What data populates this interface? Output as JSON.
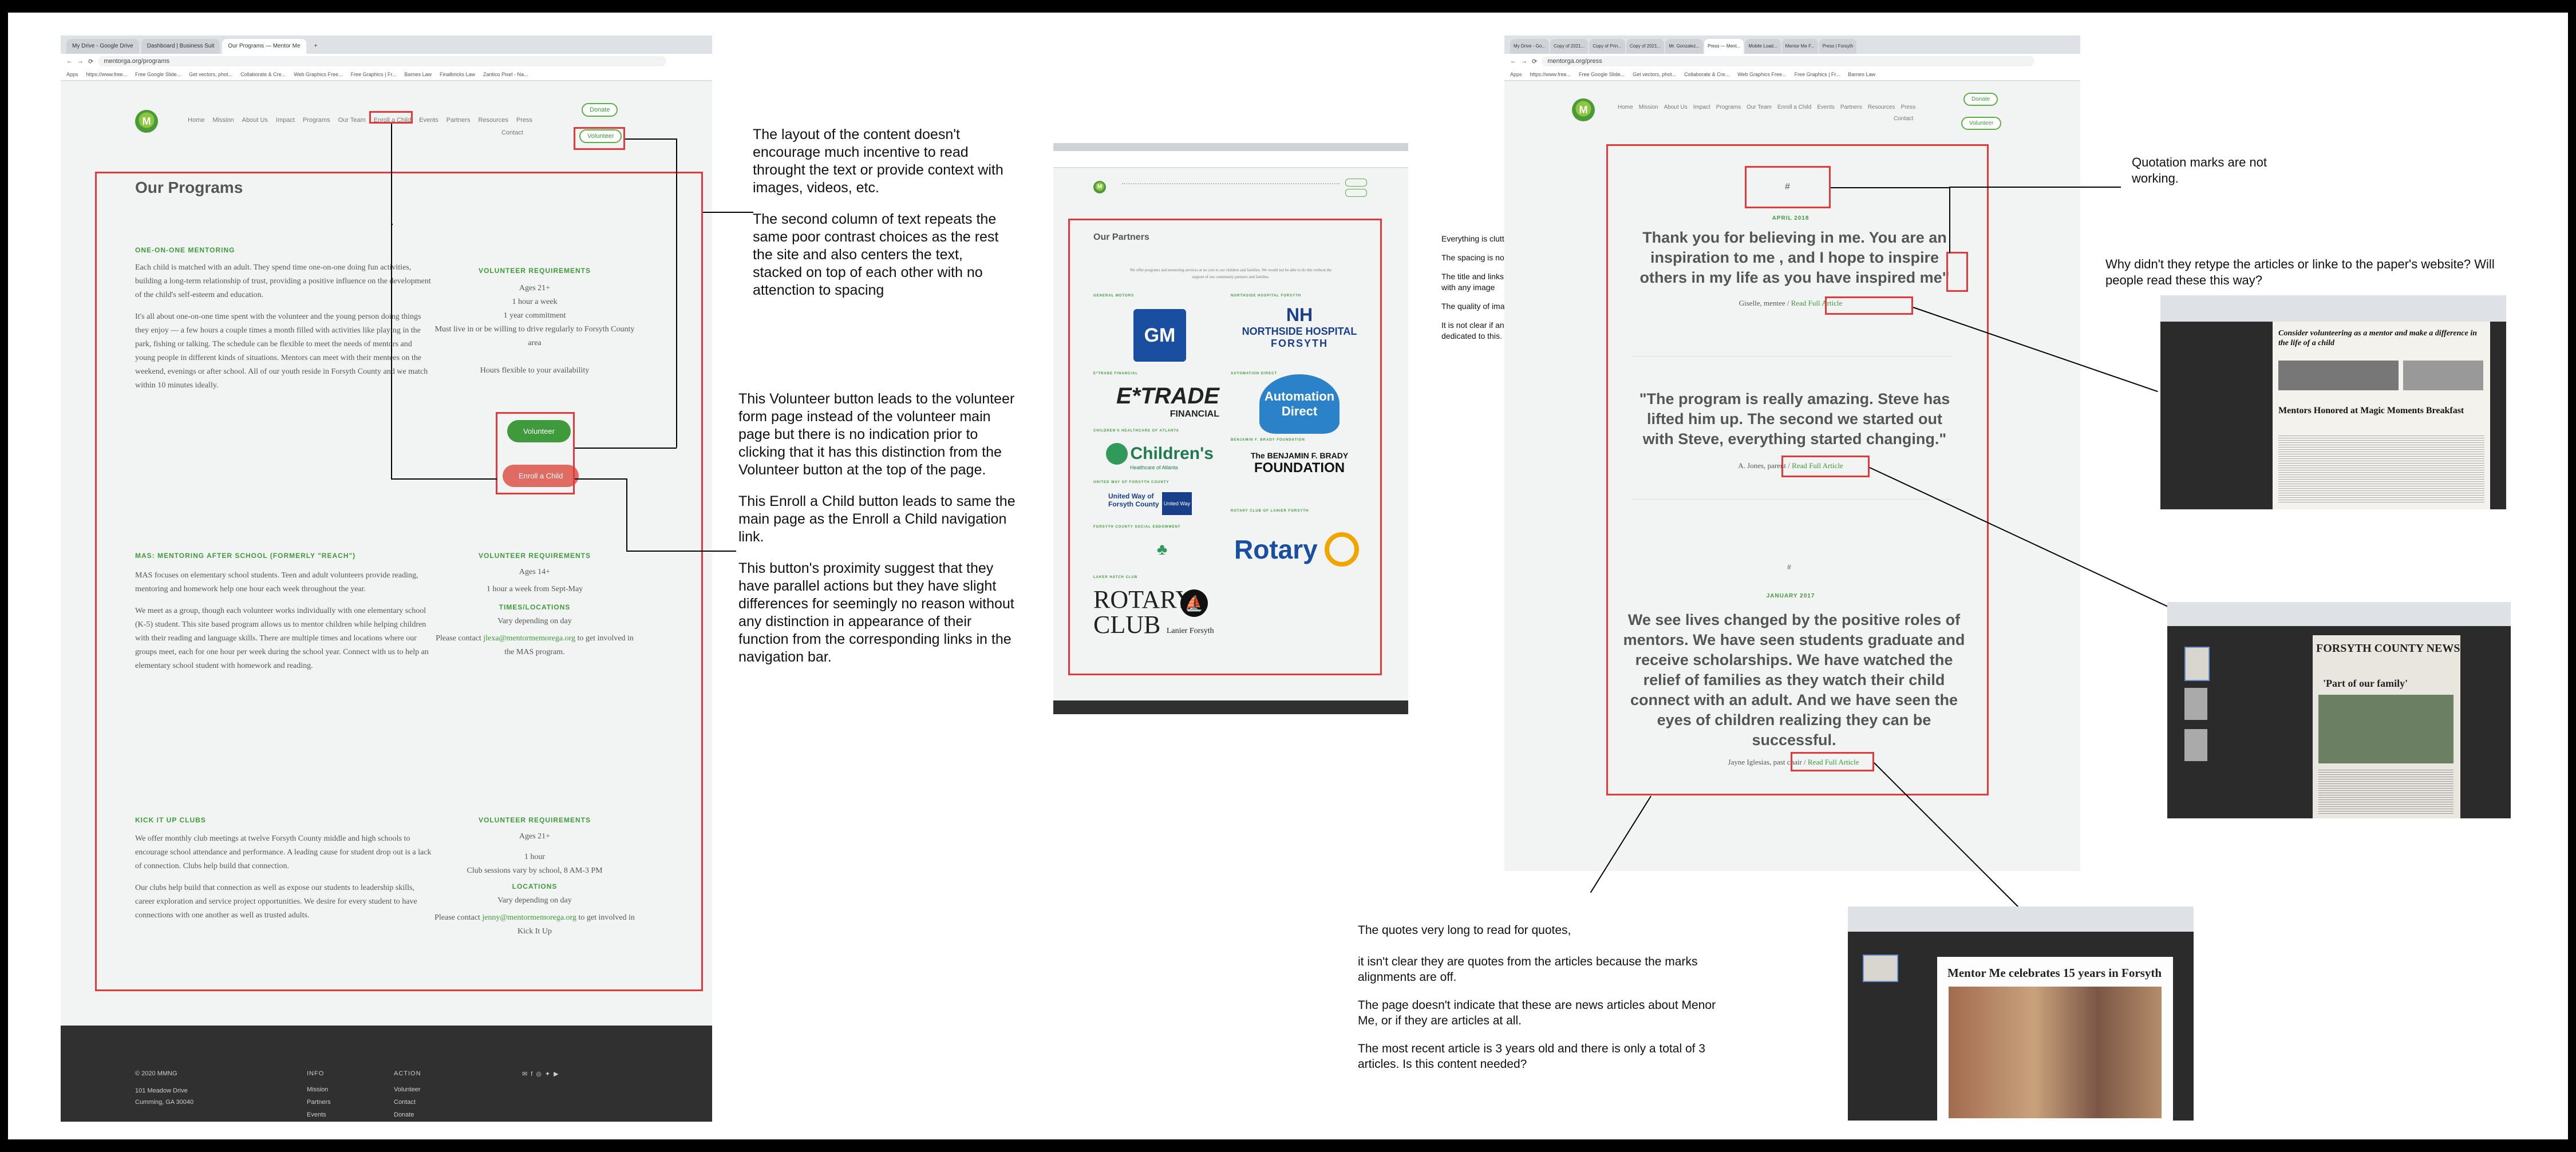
{
  "colors": {
    "accent_green": "#3e9a3a",
    "annotation_red": "#e23a3a",
    "button_red": "#e06b63",
    "footer_bg": "#303030",
    "site_bg": "#f2f4f3"
  },
  "shot1": {
    "tabs": [
      "My Drive - Google Drive",
      "Dashboard | Business Suit",
      "Our Programs — Mentor Me"
    ],
    "url": "mentorga.org/programs",
    "bookmarks": [
      "Apps",
      "https://www.free...",
      "Free Google Slide...",
      "Get vectors, phot...",
      "Collaborate & Cre...",
      "Web Graphics Free...",
      "Free Graphics | Fr...",
      "Barnes Law",
      "Finalbricks Law",
      "Zantico Pixel - Na..."
    ],
    "nav": [
      "Home",
      "Mission",
      "About Us",
      "Impact",
      "Programs",
      "Our Team",
      "Enroll a Child",
      "Events",
      "Partners",
      "Resources",
      "Press",
      "Contact"
    ],
    "donate": "Donate",
    "volunteer_top": "Volunteer",
    "page_title": "Our Programs",
    "sections": [
      {
        "heading": "ONE-ON-ONE MENTORING",
        "paragraphs": [
          "Each child is matched with an adult. They spend time one-on-one doing fun activities, building a long-term relationship of trust, providing a positive influence on the development of the child's self-esteem and education.",
          "It's all about one-on-one time spent with the volunteer and the young person doing things they enjoy — a few hours a couple times a month filled with activities like playing in the park, fishing or talking. The schedule can be flexible to meet the needs of mentors and young people in different kinds of situations. Mentors can meet with their mentees on the weekend, evenings or after school. All of our youth reside in Forsyth County and we match within 10 minutes ideally."
        ],
        "req_head": "VOLUNTEER REQUIREMENTS",
        "req_lines": [
          "Ages 21+",
          "1 hour a week",
          "1 year commitment",
          "Must live in or be willing to drive regularly to Forsyth County area",
          "",
          "Hours flexible to your availability"
        ]
      },
      {
        "heading": "MAS: MENTORING AFTER SCHOOL (FORMERLY \"REACH\")",
        "paragraphs": [
          "MAS focuses on elementary school students. Teen and adult volunteers provide reading, mentoring and homework help one hour each week throughout the year.",
          "We meet as a group, though each volunteer works individually with one elementary school (K-5) student. This site based program allows us to mentor children while helping children with their reading and language skills. There are multiple times and locations where our groups meet, each for one hour per week during the school year. Connect with us to help an elementary school student with homework and reading."
        ],
        "req_head": "VOLUNTEER REQUIREMENTS",
        "req_lines": [
          "Ages 14+",
          "1 hour a week from Sept-May"
        ],
        "times_head": "TIMES/LOCATIONS",
        "times_lines": [
          "Vary depending on day"
        ],
        "contact_pre": "Please contact",
        "contact_email": "jlexa@mentormemorega.org",
        "contact_post": "to get involved in the MAS program."
      },
      {
        "heading": "KICK IT UP CLUBS",
        "paragraphs": [
          "We offer monthly club meetings at twelve Forsyth County middle and high schools to encourage school attendance and performance. A leading cause for student drop out is a lack of connection. Clubs help build that connection.",
          "Our clubs help build that connection as well as expose our students to leadership skills, career exploration and service project opportunities. We desire for every student to have connections with one another as well as trusted adults."
        ],
        "req_head": "VOLUNTEER REQUIREMENTS",
        "req_lines": [
          "Ages 21+",
          "",
          "1 hour",
          "Club sessions vary by school, 8 AM-3 PM"
        ],
        "times_head": "LOCATIONS",
        "times_lines": [
          "Vary depending on day"
        ],
        "contact_pre": "Please contact",
        "contact_email": "jenny@mentormemorega.org",
        "contact_post": "to get involved in Kick It Up"
      }
    ],
    "btn_volunteer": "Volunteer",
    "btn_enroll": "Enroll a Child",
    "footer": {
      "copyright": "© 2020 MMNG",
      "addr1": "101 Meadow Drive",
      "addr2": "Cumming, GA 30040",
      "info_head": "INFO",
      "info_links": [
        "Mission",
        "Partners",
        "Events"
      ],
      "action_head": "ACTION",
      "action_links": [
        "Volunteer",
        "Contact",
        "Donate"
      ]
    }
  },
  "notes1": {
    "p1": "The layout of the content doesn't encourage much incentive to read throught the text or provide context with images, videos, etc.",
    "p2": "The second column of text repeats the same poor contrast choices as the rest the site and also centers the text, stacked on top of each other with no attenction to spacing",
    "p3": "This Volunteer button leads to the volunteer form page instead of the volunteer main page but there is no indication prior to clicking that it has this distinction from the Volunteer button at the top of the page.",
    "p4": "This Enroll a Child button leads to same the main page as the Enroll a Child navigation link.",
    "p5": "This button's proximity suggest that they have parallel actions but they have slight differences for seemingly no reason without any distinction in appearance of their function from the corresponding links in the navigation bar."
  },
  "shot2": {
    "title": "Our Partners",
    "intro": "We offer programs and mentoring services at no cost to our children and families. We would not be able to do this without the support of our community partners and families.",
    "groups": [
      "GENERAL MOTORS",
      "NORTHSIDE HOSPITAL FORSYTH",
      "E*TRADE FINANCIAL",
      "AUTOMATION DIRECT",
      "CHILDREN'S HEALTHCARE OF ATLANTA",
      "BENJAMIN F. BRADY FOUNDATION",
      "UNITED WAY OF FORSYTH COUNTY",
      "ROTARY CLUB OF LANIER FORSYTH",
      "FORSYTH COUNTY SOCIAL ENDOWMENT",
      "LAKER HATCH CLUB"
    ],
    "logos": {
      "gm": "GM",
      "northside1": "NORTHSIDE HOSPITAL",
      "northside2": "FORSYTH",
      "etrade1": "E*TRADE",
      "etrade2": "FINANCIAL",
      "automation": "Automation Direct",
      "childrens1": "Children's",
      "childrens2": "Healthcare of Atlanta",
      "brady1": "The BENJAMIN F. BRADY",
      "brady2": "FOUNDATION",
      "unitedway1": "United Way of",
      "unitedway2": "Forsyth County",
      "rotary": "Rotary",
      "rotaryclub1": "ROTARY",
      "rotaryclub2": "CLUB",
      "rotaryclub3": "Lanier Forsyth"
    }
  },
  "notes2": {
    "p1": "Everything is cluttered and disorganized.",
    "p2": "The spacing is not consistent",
    "p3": "The title and links are not clearly associated with any image",
    "p4": "The quality of images used also isn't coistent.",
    "p5": "It is not clear if any entire page needs to be dedicated to this."
  },
  "shot3": {
    "url": "mentorga.org/press",
    "tabs": [
      "My Drive - Go...",
      "Copy of 2021...",
      "Copy of Prin...",
      "Copy of 2021...",
      "Mr. Gonzalez...",
      "Press — Ment...",
      "Mobile Load...",
      "Mentor Me F...",
      "Press | Forsyth"
    ],
    "hash1": "#",
    "date1": "APRIL 2018",
    "quote1": "Thank you for believing in me. You are an inspiration to me , and I hope to inspire others in my life as you have inspired me\"",
    "attrib1_pre": "Giselle, mentee /",
    "read": "Read Full Article",
    "quote2": "\"The program is really amazing.  Steve has lifted him up.  The second we started out with Steve, everything started changing.\"",
    "attrib2_pre": "A. Jones, parent /",
    "hash3": "#",
    "date3": "JANUARY 2017",
    "quote3": "We see lives changed by the positive roles of mentors.  We have seen students graduate and receive scholarships.  We have watched the relief of families as they watch their child connect with an adult. And we have seen the eyes of children realizing they can be successful.",
    "attrib3_pre": "Jayne Iglesias, past chair /"
  },
  "notes3": {
    "quotes_marks": "Quotation marks are not working.",
    "retype": "Why didn't they retype the articles or linke to the paper's website? Will people read these this way?",
    "bottom1": "The quotes very long to read for quotes,",
    "bottom2": "it isn't clear they are quotes from the articles because the marks alignments are off.",
    "bottom3": "The page doesn't indicate that these are news articles about Menor Me, or if they are articles at all.",
    "bottom4": "The most recent article is 3 years old and there is only a total of 3 articles. Is this content needed?"
  },
  "articles": {
    "a1_headline": "Consider volunteering as a mentor and make a difference in the life of a child",
    "a1_sub": "Mentors Honored at Magic Moments Breakfast",
    "a2_masthead": "FORSYTH COUNTY NEWS",
    "a2_headline": "'Part of our family'",
    "a3_headline": "Mentor Me celebrates 15 years in Forsyth"
  }
}
